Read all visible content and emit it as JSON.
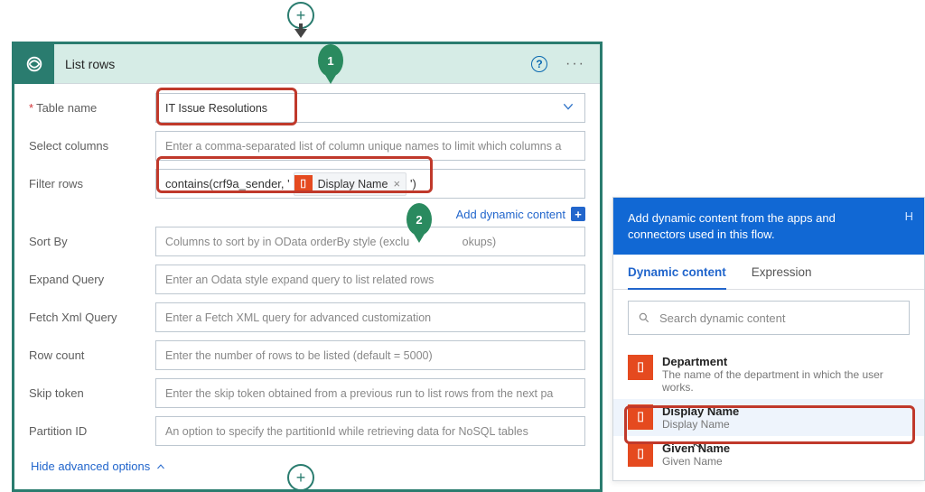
{
  "header": {
    "title": "List rows"
  },
  "fields": {
    "table_name_label": "Table name",
    "table_name_value": "IT Issue Resolutions",
    "select_columns_label": "Select columns",
    "select_columns_placeholder": "Enter a comma-separated list of column unique names to limit which columns a",
    "filter_rows_label": "Filter rows",
    "filter_prefix": "contains(crf9a_sender, '",
    "filter_token_label": "Display Name",
    "filter_suffix": "')",
    "sort_by_label": "Sort By",
    "sort_by_placeholder": "Columns to sort by in OData orderBy style (exclu",
    "sort_by_placeholder_tail": "okups)",
    "expand_query_label": "Expand Query",
    "expand_query_placeholder": "Enter an Odata style expand query to list related rows",
    "fetch_xml_label": "Fetch Xml Query",
    "fetch_xml_placeholder": "Enter a Fetch XML query for advanced customization",
    "row_count_label": "Row count",
    "row_count_placeholder": "Enter the number of rows to be listed (default = 5000)",
    "skip_token_label": "Skip token",
    "skip_token_placeholder": "Enter the skip token obtained from a previous run to list rows from the next pa",
    "partition_id_label": "Partition ID",
    "partition_id_placeholder": "An option to specify the partitionId while retrieving data for NoSQL tables"
  },
  "links": {
    "add_dynamic_content": "Add dynamic content",
    "hide_advanced": "Hide advanced options"
  },
  "badges": {
    "b1": "1",
    "b2": "2"
  },
  "panel": {
    "intro": "Add dynamic content from the apps and connectors used in this flow.",
    "h_link": "H",
    "tabs": {
      "dynamic": "Dynamic content",
      "expression": "Expression"
    },
    "search_placeholder": "Search dynamic content",
    "items": [
      {
        "title": "Department",
        "sub": "The name of the department in which the user works."
      },
      {
        "title": "Display Name",
        "sub": "Display Name"
      },
      {
        "title": "Given Name",
        "sub": "Given Name"
      }
    ]
  }
}
